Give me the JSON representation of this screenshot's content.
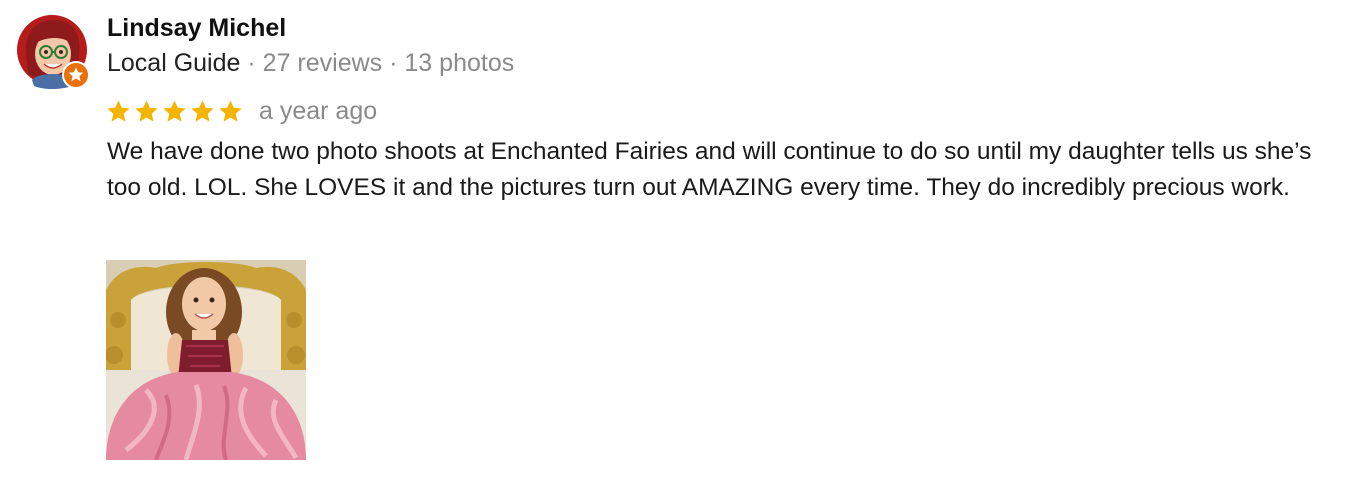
{
  "reviewer": {
    "name": "Lindsay Michel",
    "badge": "Local Guide",
    "reviews_count": "27 reviews",
    "photos_count": "13 photos",
    "separator": "·"
  },
  "review": {
    "rating": 5,
    "max_rating": 5,
    "date": "a year ago",
    "text": "We have done two photo shoots at Enchanted Fairies and will continue to do so until my daughter tells us she’s too old. LOL. She LOVES it and the pictures turn out AMAZING every time. They do incredibly precious work."
  },
  "icons": {
    "avatar": "avatar-icon",
    "local_guide_badge": "local-guide-star-icon",
    "star": "star-icon",
    "photo": "photo-thumbnail"
  },
  "colors": {
    "star": "#f4b400",
    "badge": "#e8710a",
    "muted_text": "#8a8a8a"
  }
}
